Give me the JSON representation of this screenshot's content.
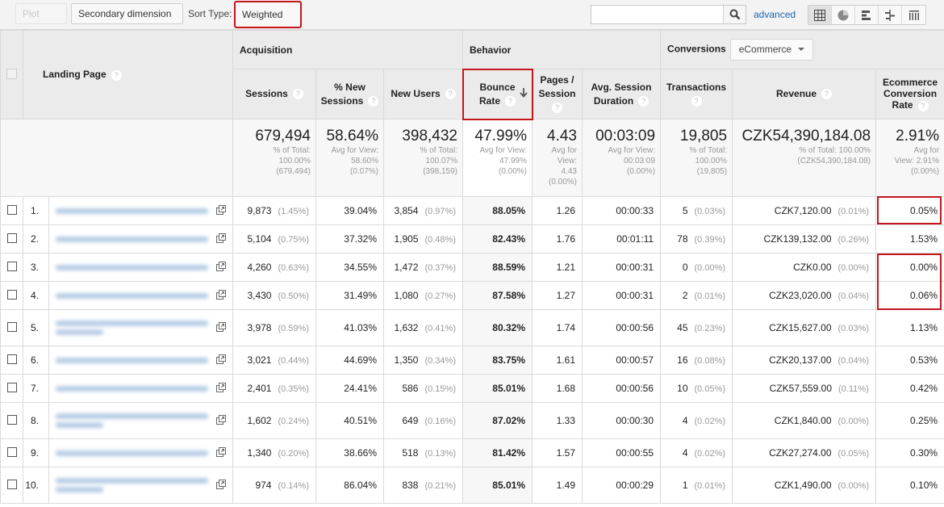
{
  "toolbar": {
    "plot_rows": "Plot Rows",
    "secondary_dimension": "Secondary dimension",
    "sort_type_label": "Sort Type:",
    "sort_type_value": "Weighted",
    "search_placeholder": "",
    "advanced": "advanced",
    "views": [
      "table-view",
      "pie-view",
      "performance-view",
      "comparison-view",
      "pivot-view"
    ],
    "active_view": "table-view"
  },
  "headers": {
    "landing_page": "Landing Page",
    "groups": {
      "acquisition": "Acquisition",
      "behavior": "Behavior",
      "conversions": "Conversions",
      "conversions_select": "eCommerce"
    },
    "columns": {
      "sessions": "Sessions",
      "pct_new_sessions_1": "% New",
      "pct_new_sessions_2": "Sessions",
      "new_users": "New Users",
      "bounce_rate_1": "Bounce",
      "bounce_rate_2": "Rate",
      "pages_session_1": "Pages /",
      "pages_session_2": "Session",
      "avg_duration_1": "Avg. Session",
      "avg_duration_2": "Duration",
      "transactions": "Transactions",
      "revenue": "Revenue",
      "ecr_1": "Ecommerce",
      "ecr_2": "Conversion",
      "ecr_3": "Rate"
    },
    "help": "?"
  },
  "totals": {
    "sessions": {
      "value": "679,494",
      "l1": "% of Total:",
      "l2": "100.00%",
      "l3": "(679,494)"
    },
    "pct_new_sessions": {
      "value": "58.64%",
      "l1": "Avg for View:",
      "l2": "58.60%",
      "l3": "(0.07%)"
    },
    "new_users": {
      "value": "398,432",
      "l1": "% of Total:",
      "l2": "100.07%",
      "l3": "(398,159)"
    },
    "bounce_rate": {
      "value": "47.99%",
      "l1": "Avg for View:",
      "l2": "47.99%",
      "l3": "(0.00%)"
    },
    "pages_session": {
      "value": "4.43",
      "l1": "Avg for",
      "l2": "View:",
      "l3": "4.43",
      "l4": "(0.00%)"
    },
    "avg_duration": {
      "value": "00:03:09",
      "l1": "Avg for View:",
      "l2": "00:03:09",
      "l3": "(0.00%)"
    },
    "transactions": {
      "value": "19,805",
      "l1": "% of Total:",
      "l2": "100.00%",
      "l3": "(19,805)"
    },
    "revenue": {
      "value": "CZK54,390,184.08",
      "l1": "% of Total: 100.00%",
      "l2": "(CZK54,390,184.08)"
    },
    "ecr": {
      "value": "2.91%",
      "l1": "Avg for",
      "l2": "View: 2.91%",
      "l3": "(0.00%)"
    }
  },
  "rows": [
    {
      "idx": "1.",
      "sessions": "9,873",
      "sessions_pct": "(1.45%)",
      "pct_new": "39.04%",
      "new_users": "3,854",
      "new_users_pct": "(0.97%)",
      "bounce": "88.05%",
      "pages": "1.26",
      "duration": "00:00:33",
      "trans": "5",
      "trans_pct": "(0.03%)",
      "revenue": "CZK7,120.00",
      "revenue_pct": "(0.01%)",
      "ecr": "0.05%"
    },
    {
      "idx": "2.",
      "sessions": "5,104",
      "sessions_pct": "(0.75%)",
      "pct_new": "37.32%",
      "new_users": "1,905",
      "new_users_pct": "(0.48%)",
      "bounce": "82.43%",
      "pages": "1.76",
      "duration": "00:01:11",
      "trans": "78",
      "trans_pct": "(0.39%)",
      "revenue": "CZK139,132.00",
      "revenue_pct": "(0.26%)",
      "ecr": "1.53%"
    },
    {
      "idx": "3.",
      "sessions": "4,260",
      "sessions_pct": "(0.63%)",
      "pct_new": "34.55%",
      "new_users": "1,472",
      "new_users_pct": "(0.37%)",
      "bounce": "88.59%",
      "pages": "1.21",
      "duration": "00:00:31",
      "trans": "0",
      "trans_pct": "(0.00%)",
      "revenue": "CZK0.00",
      "revenue_pct": "(0.00%)",
      "ecr": "0.00%"
    },
    {
      "idx": "4.",
      "sessions": "3,430",
      "sessions_pct": "(0.50%)",
      "pct_new": "31.49%",
      "new_users": "1,080",
      "new_users_pct": "(0.27%)",
      "bounce": "87.58%",
      "pages": "1.27",
      "duration": "00:00:31",
      "trans": "2",
      "trans_pct": "(0.01%)",
      "revenue": "CZK23,020.00",
      "revenue_pct": "(0.04%)",
      "ecr": "0.06%"
    },
    {
      "idx": "5.",
      "sessions": "3,978",
      "sessions_pct": "(0.59%)",
      "pct_new": "41.03%",
      "new_users": "1,632",
      "new_users_pct": "(0.41%)",
      "bounce": "80.32%",
      "pages": "1.74",
      "duration": "00:00:56",
      "trans": "45",
      "trans_pct": "(0.23%)",
      "revenue": "CZK15,627.00",
      "revenue_pct": "(0.03%)",
      "ecr": "1.13%"
    },
    {
      "idx": "6.",
      "sessions": "3,021",
      "sessions_pct": "(0.44%)",
      "pct_new": "44.69%",
      "new_users": "1,350",
      "new_users_pct": "(0.34%)",
      "bounce": "83.75%",
      "pages": "1.61",
      "duration": "00:00:57",
      "trans": "16",
      "trans_pct": "(0.08%)",
      "revenue": "CZK20,137.00",
      "revenue_pct": "(0.04%)",
      "ecr": "0.53%"
    },
    {
      "idx": "7.",
      "sessions": "2,401",
      "sessions_pct": "(0.35%)",
      "pct_new": "24.41%",
      "new_users": "586",
      "new_users_pct": "(0.15%)",
      "bounce": "85.01%",
      "pages": "1.68",
      "duration": "00:00:56",
      "trans": "10",
      "trans_pct": "(0.05%)",
      "revenue": "CZK57,559.00",
      "revenue_pct": "(0.11%)",
      "ecr": "0.42%"
    },
    {
      "idx": "8.",
      "sessions": "1,602",
      "sessions_pct": "(0.24%)",
      "pct_new": "40.51%",
      "new_users": "649",
      "new_users_pct": "(0.16%)",
      "bounce": "87.02%",
      "pages": "1.33",
      "duration": "00:00:30",
      "trans": "4",
      "trans_pct": "(0.02%)",
      "revenue": "CZK1,840.00",
      "revenue_pct": "(0.00%)",
      "ecr": "0.25%"
    },
    {
      "idx": "9.",
      "sessions": "1,340",
      "sessions_pct": "(0.20%)",
      "pct_new": "38.66%",
      "new_users": "518",
      "new_users_pct": "(0.13%)",
      "bounce": "81.42%",
      "pages": "1.57",
      "duration": "00:00:55",
      "trans": "4",
      "trans_pct": "(0.02%)",
      "revenue": "CZK27,274.00",
      "revenue_pct": "(0.05%)",
      "ecr": "0.30%"
    },
    {
      "idx": "10.",
      "sessions": "974",
      "sessions_pct": "(0.14%)",
      "pct_new": "86.04%",
      "new_users": "838",
      "new_users_pct": "(0.21%)",
      "bounce": "85.01%",
      "pages": "1.49",
      "duration": "00:00:29",
      "trans": "1",
      "trans_pct": "(0.01%)",
      "revenue": "CZK1,490.00",
      "revenue_pct": "(0.00%)",
      "ecr": "0.10%"
    }
  ],
  "colors": {
    "highlight": "#c4161c",
    "link": "#1a66b3"
  }
}
